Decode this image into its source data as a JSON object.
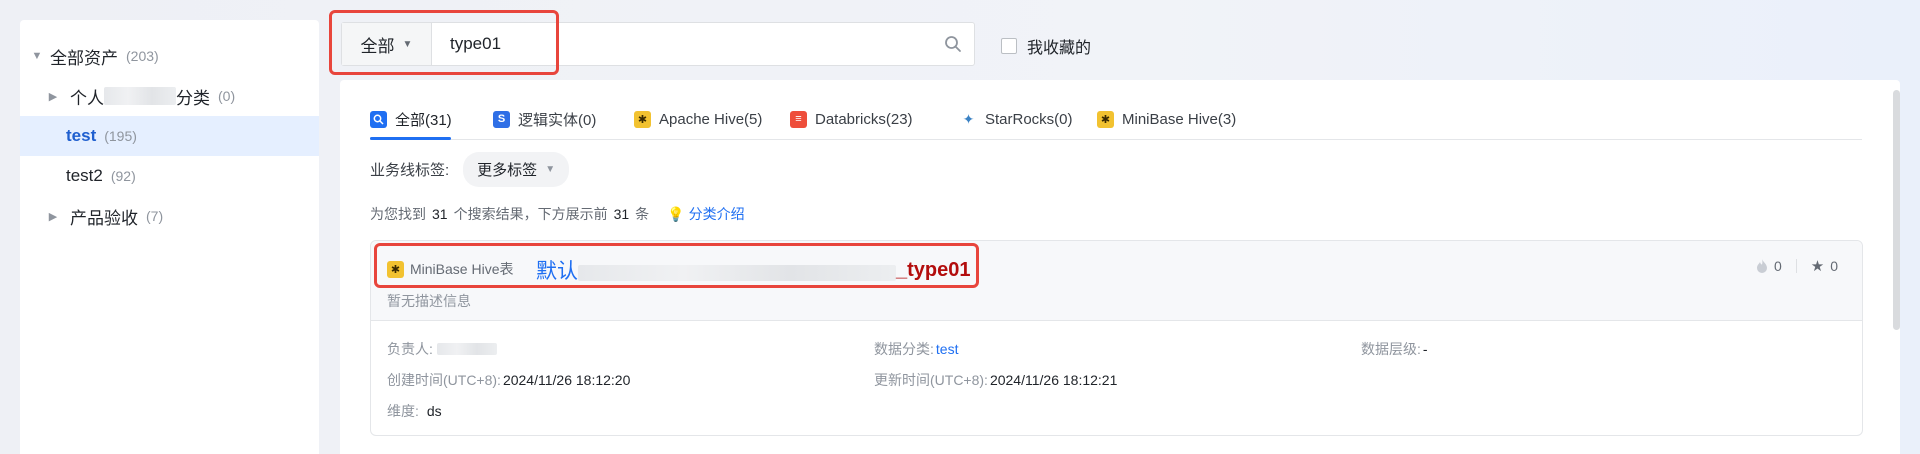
{
  "sidebar": {
    "items": [
      {
        "label": "全部资产",
        "count": "(203)",
        "expanded": true
      },
      {
        "label_prefix": "个人",
        "label_suffix": "分类",
        "count": "(0)",
        "expanded": false
      },
      {
        "label": "test",
        "count": "(195)",
        "selected": true
      },
      {
        "label": "test2",
        "count": "(92)"
      },
      {
        "label": "产品验收",
        "count": "(7)",
        "expanded": false
      }
    ]
  },
  "search": {
    "scope": "全部",
    "value": "type01",
    "favorites_label": "我收藏的"
  },
  "tabs": [
    {
      "label": "全部(31)",
      "icon": "search-icon",
      "active": true
    },
    {
      "label": "逻辑实体(0)",
      "icon": "logical-entity-icon"
    },
    {
      "label": "Apache Hive(5)",
      "icon": "hive-icon"
    },
    {
      "label": "Databricks(23)",
      "icon": "databricks-icon"
    },
    {
      "label": "StarRocks(0)",
      "icon": "starrocks-icon"
    },
    {
      "label": "MiniBase Hive(3)",
      "icon": "hive-icon"
    }
  ],
  "filter": {
    "label": "业务线标签:",
    "more_tags": "更多标签"
  },
  "summary": {
    "prefix": "为您找到",
    "total": "31",
    "middle": "个搜索结果，下方展示前",
    "shown": "31",
    "suffix": "条",
    "intro_link": "分类介绍"
  },
  "result": {
    "type_label": "MiniBase Hive表",
    "name_prefix": "默认",
    "name_suffix": "_type01",
    "description": "暂无描述信息",
    "hot_count": "0",
    "star_count": "0",
    "owner_label": "负责人:",
    "category_label": "数据分类:",
    "category_value": "test",
    "level_label": "数据层级:",
    "level_value": "-",
    "created_label": "创建时间(UTC+8):",
    "created_value": "2024/11/26 18:12:20",
    "updated_label": "更新时间(UTC+8):",
    "updated_value": "2024/11/26 18:12:21",
    "dimension_label": "维度:",
    "dimension_value": "ds"
  },
  "colors": {
    "accent": "#1f6ff2",
    "highlight": "#e8453c",
    "keyword": "#b30d0d"
  }
}
